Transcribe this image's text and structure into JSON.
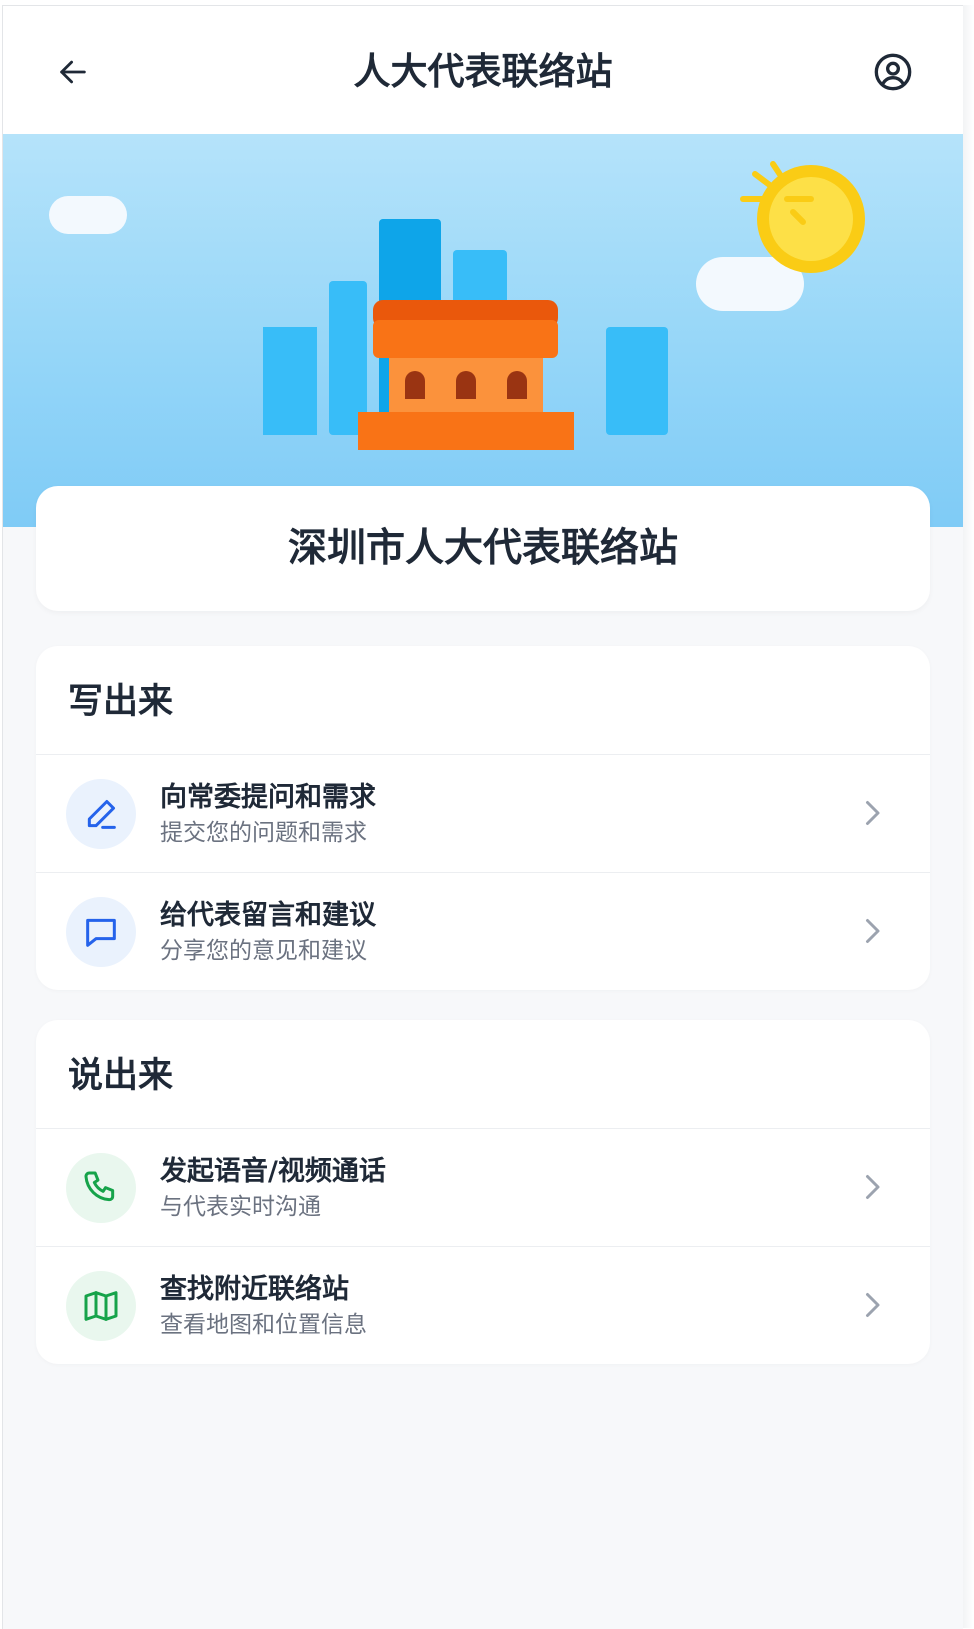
{
  "header": {
    "title": "人大代表联络站",
    "back_icon": "arrow-left-icon",
    "user_icon": "user-circle-icon"
  },
  "hero": {
    "station_name": "深圳市人大代表联络站"
  },
  "sections": [
    {
      "title": "写出来",
      "items": [
        {
          "label": "向常委提问和需求",
          "sub": "提交您的问题和需求",
          "icon": "pencil-icon"
        },
        {
          "label": "给代表留言和建议",
          "sub": "分享您的意见和建议",
          "icon": "chat-bubble-icon"
        }
      ]
    },
    {
      "title": "说出来",
      "items": [
        {
          "label": "发起语音/视频通话",
          "sub": "与代表实时沟通",
          "icon": "phone-icon"
        },
        {
          "label": "查找附近联络站",
          "sub": "查看地图和位置信息",
          "icon": "map-icon"
        }
      ]
    }
  ],
  "colors": {
    "accent_blue": "#2563eb",
    "accent_green": "#16a34a",
    "building_orange": "#f97316",
    "sky": "#93d5f8"
  }
}
